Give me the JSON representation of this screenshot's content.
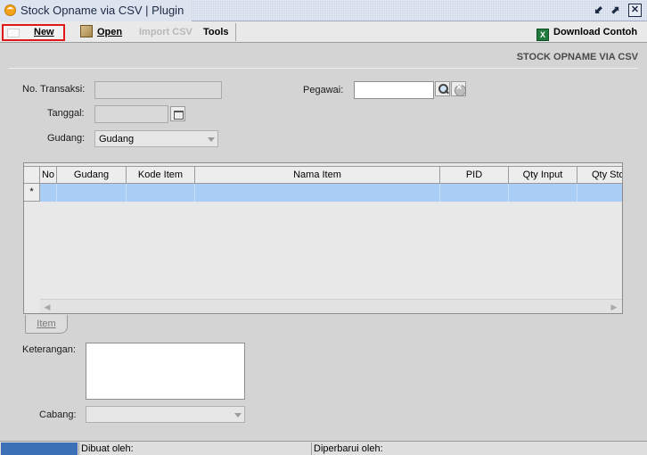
{
  "window": {
    "title": "Stock Opname via CSV | Plugin",
    "minimize_glyph": "⬋",
    "maximize_glyph": "⬈",
    "close_glyph": "✕"
  },
  "toolbar": {
    "new_label": "New",
    "open_label": "Open",
    "import_csv_label": "Import CSV",
    "tools_label": "Tools",
    "download_label": "Download Contoh"
  },
  "form": {
    "heading": "STOCK OPNAME VIA CSV",
    "no_transaksi_label": "No. Transaksi:",
    "no_transaksi_value": "",
    "tanggal_label": "Tanggal:",
    "tanggal_value": "",
    "gudang_label": "Gudang:",
    "gudang_value": "Gudang",
    "pegawai_label": "Pegawai:",
    "pegawai_value": "",
    "keterangan_label": "Keterangan:",
    "keterangan_value": "",
    "cabang_label": "Cabang:",
    "cabang_value": ""
  },
  "grid": {
    "columns": [
      "No",
      "Gudang",
      "Kode Item",
      "Nama Item",
      "PID",
      "Qty Input",
      "Qty Sto"
    ],
    "new_row_marker": "*",
    "scroll_left_glyph": "◀",
    "scroll_right_glyph": "▶"
  },
  "tabs": [
    {
      "label": "Item"
    }
  ],
  "status": {
    "dibuat_label": "Dibuat oleh:",
    "diperbarui_label": "Diperbarui oleh:"
  },
  "colors": {
    "highlight_border": "#e01818",
    "selected_row": "#a9cdf4",
    "status_accent": "#3c6fb5"
  }
}
